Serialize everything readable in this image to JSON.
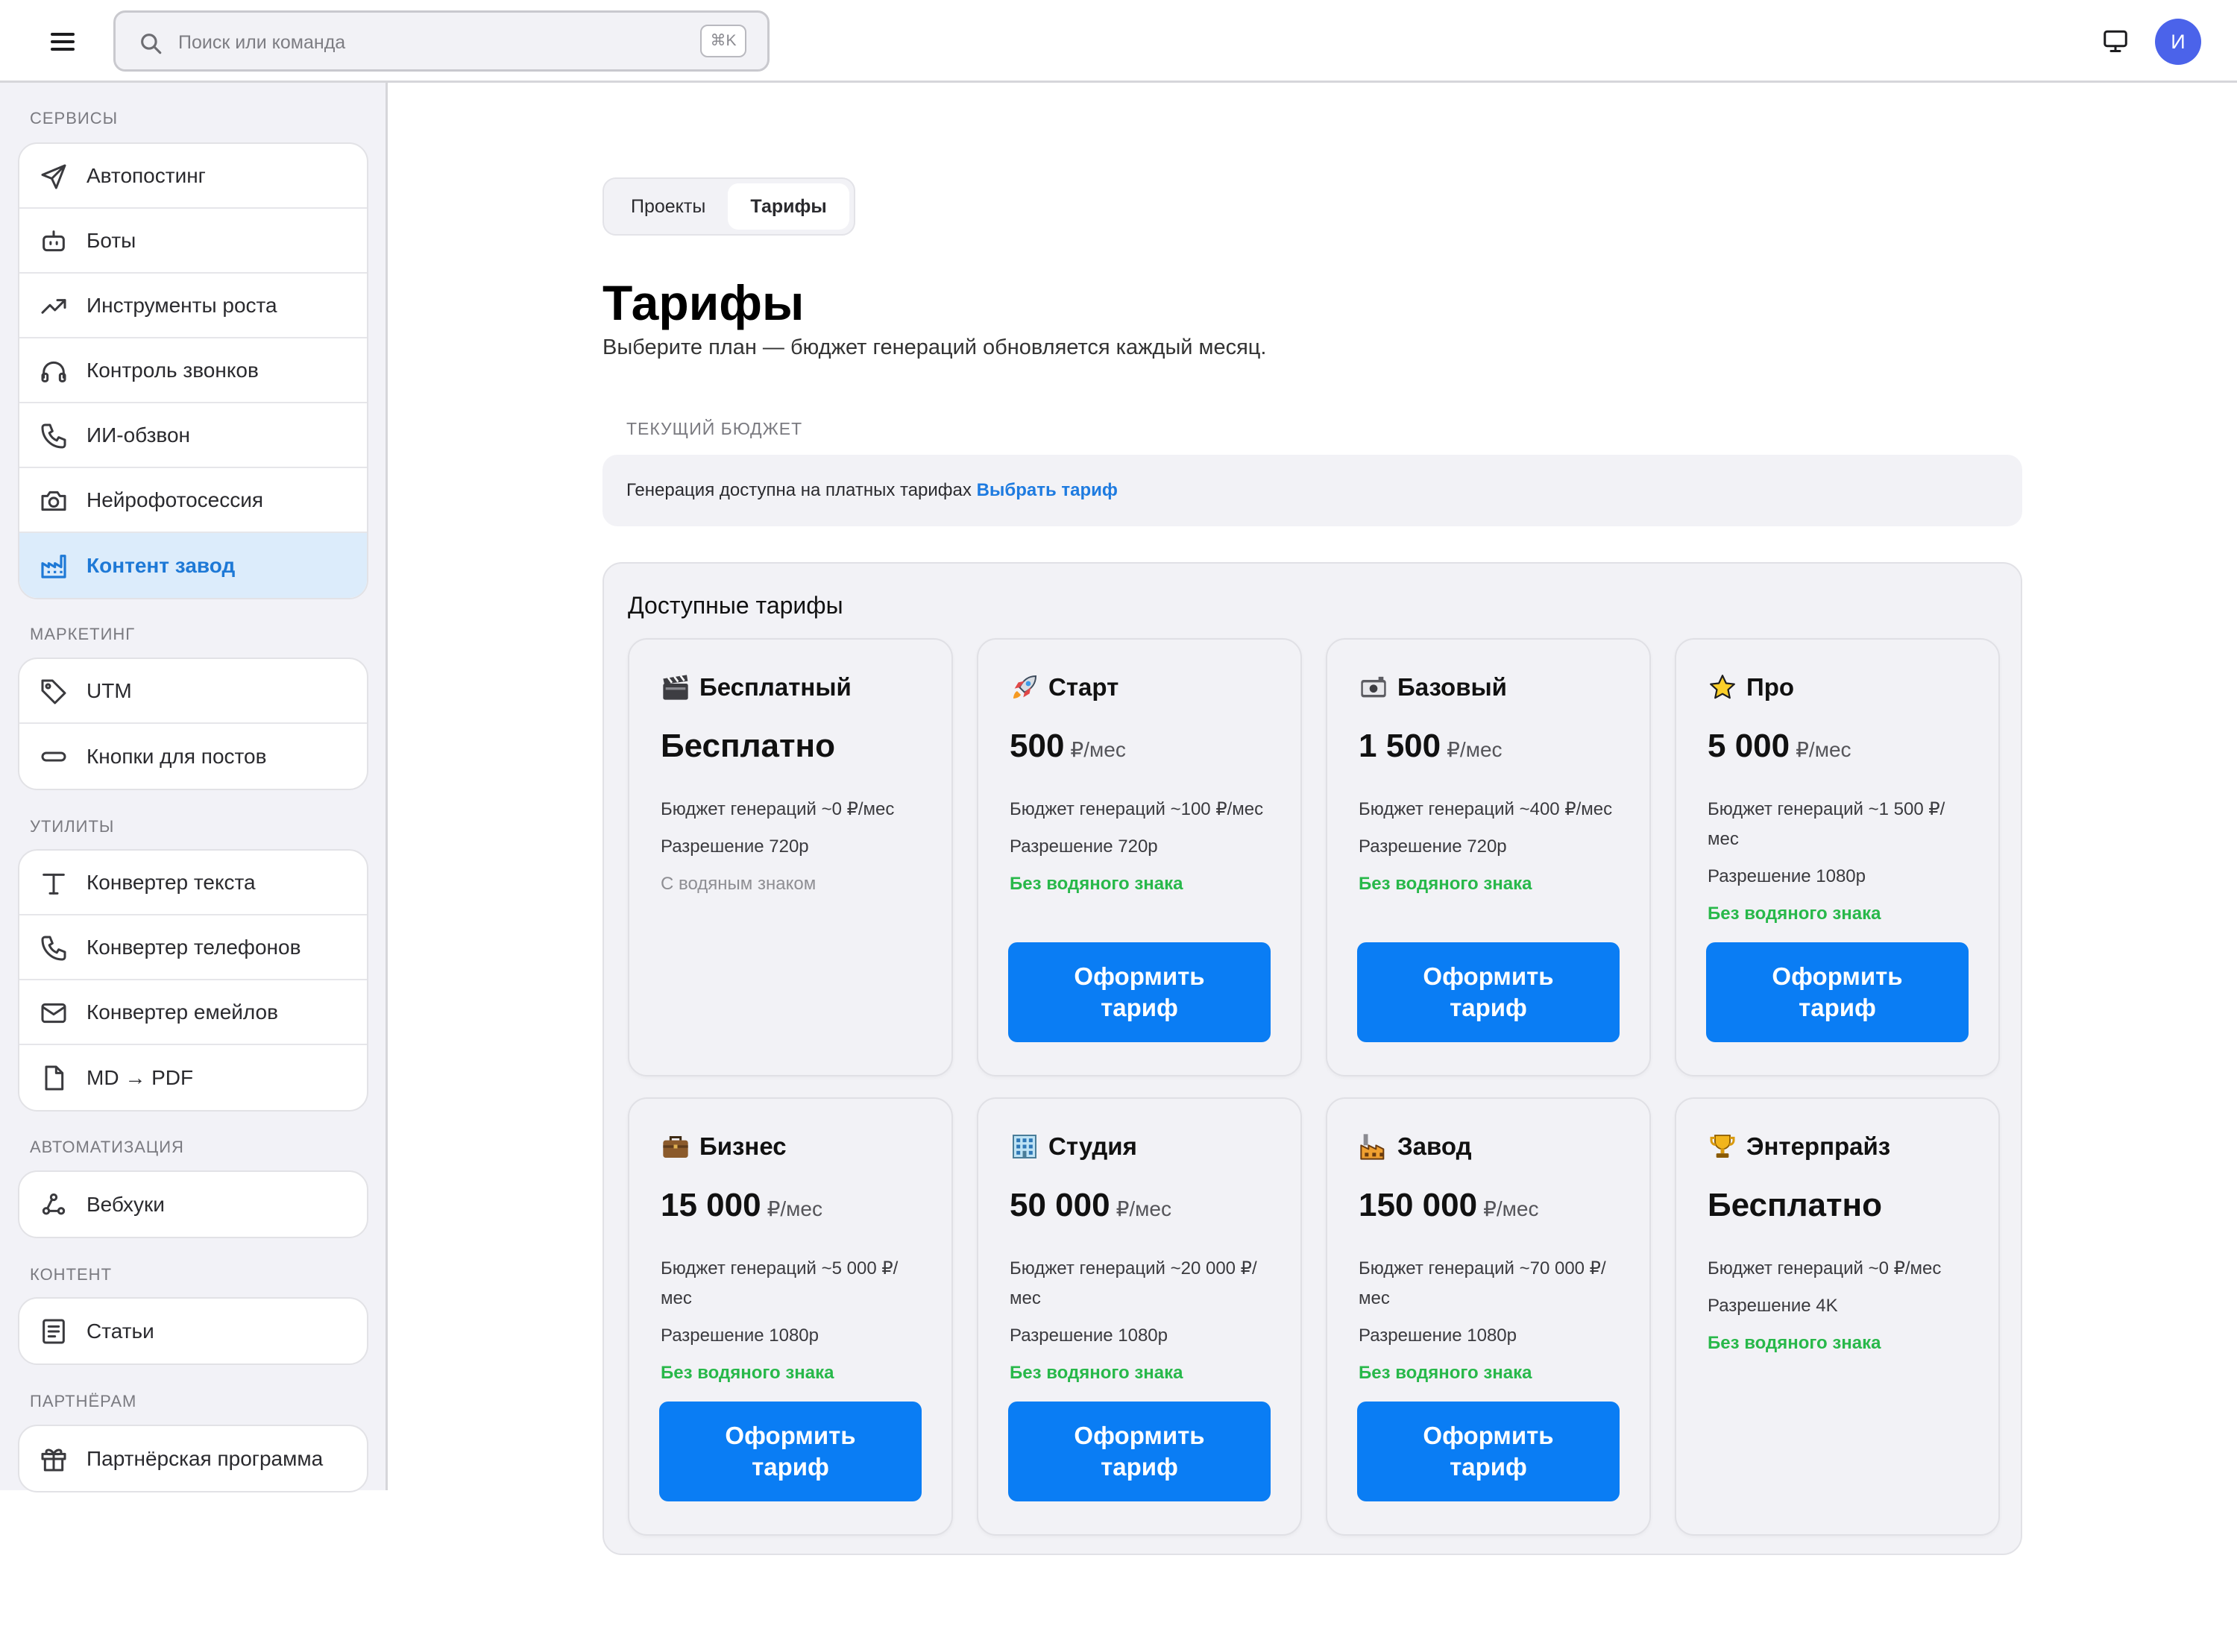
{
  "topbar": {
    "search_placeholder": "Поиск или команда",
    "search_shortcut": "⌘K",
    "avatar_initial": "И"
  },
  "sidebar": {
    "sections": [
      {
        "title": "Сервисы",
        "items": [
          {
            "label": "Автопостинг",
            "icon": "send-icon"
          },
          {
            "label": "Боты",
            "icon": "bot-icon"
          },
          {
            "label": "Инструменты роста",
            "icon": "trending-up-icon"
          },
          {
            "label": "Контроль звонков",
            "icon": "headphones-icon"
          },
          {
            "label": "ИИ-обзвон",
            "icon": "phone-icon"
          },
          {
            "label": "Нейрофотосессия",
            "icon": "camera-icon"
          },
          {
            "label": "Контент завод",
            "icon": "factory-icon",
            "active": true
          }
        ]
      },
      {
        "title": "Маркетинг",
        "items": [
          {
            "label": "UTM",
            "icon": "tag-icon"
          },
          {
            "label": "Кнопки для постов",
            "icon": "button-pill-icon"
          }
        ]
      },
      {
        "title": "Утилиты",
        "items": [
          {
            "label": "Конвертер текста",
            "icon": "text-icon"
          },
          {
            "label": "Конвертер телефонов",
            "icon": "phone-icon"
          },
          {
            "label": "Конвертер емейлов",
            "icon": "mail-icon"
          },
          {
            "label": "MD → PDF",
            "icon": "file-icon"
          }
        ]
      },
      {
        "title": "Автоматизация",
        "items": [
          {
            "label": "Вебхуки",
            "icon": "webhook-icon"
          }
        ]
      },
      {
        "title": "Контент",
        "items": [
          {
            "label": "Статьи",
            "icon": "article-icon"
          }
        ]
      },
      {
        "title": "Партнёрам",
        "items": [
          {
            "label": "Партнёрская программа",
            "icon": "gift-icon"
          }
        ]
      }
    ]
  },
  "main": {
    "tabs": [
      {
        "label": "Проекты",
        "active": false
      },
      {
        "label": "Тарифы",
        "active": true
      }
    ],
    "title": "Тарифы",
    "subtitle": "Выберите план — бюджет генераций обновляется каждый месяц.",
    "budget": {
      "label": "ТЕКУЩИЙ БЮДЖЕТ",
      "text": "Генерация доступна на платных тарифах",
      "link": "Выбрать тариф"
    },
    "plans_title": "Доступные тарифы",
    "cta_label_line1": "Оформить",
    "cta_label_line2": "тариф",
    "plans": [
      {
        "name": "Бесплатный",
        "icon": "clapperboard-icon",
        "price": "Бесплатно",
        "unit": "",
        "features": [
          "Бюджет генераций ~0 ₽/мес",
          "Разрешение 720p"
        ],
        "watermark": "С водяным знаком",
        "watermark_free": false,
        "cta": false
      },
      {
        "name": "Старт",
        "icon": "rocket-icon",
        "price": "500",
        "unit": "₽/мес",
        "features": [
          "Бюджет генераций ~100 ₽/мес",
          "Разрешение 720p"
        ],
        "watermark": "Без водяного знака",
        "watermark_free": true,
        "cta": true
      },
      {
        "name": "Базовый",
        "icon": "camera-emoji-icon",
        "price": "1 500",
        "unit": "₽/мес",
        "features": [
          "Бюджет генераций ~400 ₽/мес",
          "Разрешение 720p"
        ],
        "watermark": "Без водяного знака",
        "watermark_free": true,
        "cta": true
      },
      {
        "name": "Про",
        "icon": "star-icon",
        "price": "5 000",
        "unit": "₽/мес",
        "features": [
          "Бюджет генераций ~1 500 ₽/мес",
          "Разрешение 1080p"
        ],
        "watermark": "Без водяного знака",
        "watermark_free": true,
        "cta": true
      },
      {
        "name": "Бизнес",
        "icon": "briefcase-icon",
        "price": "15 000",
        "unit": "₽/мес",
        "features": [
          "Бюджет генераций ~5 000 ₽/мес",
          "Разрешение 1080p"
        ],
        "watermark": "Без водяного знака",
        "watermark_free": true,
        "cta": true
      },
      {
        "name": "Студия",
        "icon": "building-icon",
        "price": "50 000",
        "unit": "₽/мес",
        "features": [
          "Бюджет генераций ~20 000 ₽/мес",
          "Разрешение 1080p"
        ],
        "watermark": "Без водяного знака",
        "watermark_free": true,
        "cta": true
      },
      {
        "name": "Завод",
        "icon": "factory-emoji-icon",
        "price": "150 000",
        "unit": "₽/мес",
        "features": [
          "Бюджет генераций ~70 000 ₽/мес",
          "Разрешение 1080p"
        ],
        "watermark": "Без водяного знака",
        "watermark_free": true,
        "cta": true
      },
      {
        "name": "Энтерпрайз",
        "icon": "trophy-icon",
        "price": "Бесплатно",
        "unit": "",
        "features": [
          "Бюджет генераций ~0 ₽/мес",
          "Разрешение 4K"
        ],
        "watermark": "Без водяного знака",
        "watermark_free": true,
        "cta": false
      }
    ]
  },
  "colors": {
    "accent": "#0a7df4",
    "link": "#1e7be0",
    "active_nav_bg": "#dcecfb",
    "active_nav_text": "#1e79d6",
    "success": "#28b84a",
    "avatar": "#4b63ea"
  }
}
